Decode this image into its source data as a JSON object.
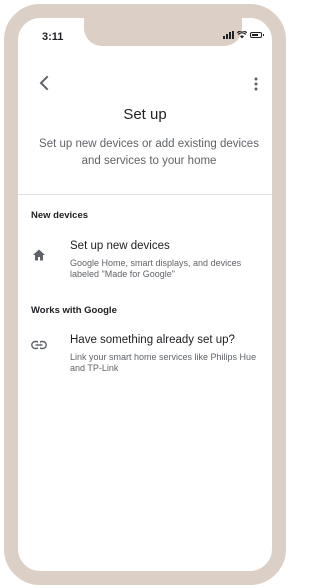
{
  "status_bar": {
    "time": "3:11"
  },
  "page": {
    "title": "Set up",
    "subtitle": "Set up new devices or add existing devices and services to your home"
  },
  "sections": [
    {
      "header": "New devices",
      "item": {
        "icon": "home-icon",
        "title": "Set up new devices",
        "description": "Google Home, smart displays, and devices labeled \"Made for Google\""
      }
    },
    {
      "header": "Works with Google",
      "item": {
        "icon": "link-icon",
        "title": "Have something already set up?",
        "description": "Link your smart home services like Philips Hue and TP-Link"
      }
    }
  ],
  "colors": {
    "frame": "#dccfc6",
    "text_primary": "#202124",
    "text_secondary": "#5f6368",
    "divider": "#e0e0e0"
  }
}
